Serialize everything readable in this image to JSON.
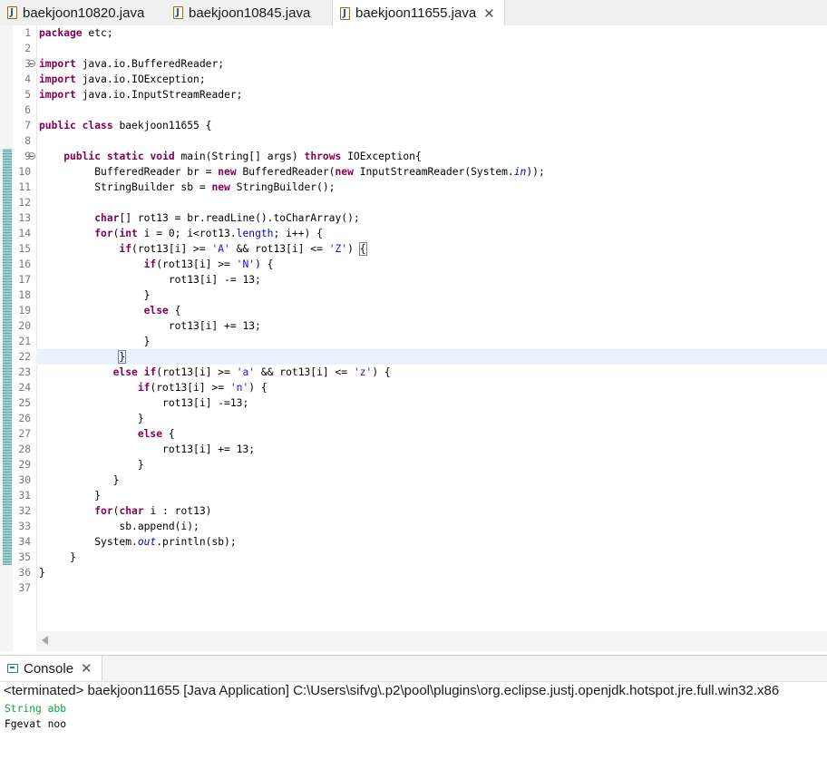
{
  "tabs": [
    {
      "label": "baekjoon10820.java",
      "active": false
    },
    {
      "label": "baekjoon10845.java",
      "active": false
    },
    {
      "label": "baekjoon11655.java",
      "active": true
    }
  ],
  "editor": {
    "current_line": 22,
    "lines": [
      {
        "n": "1",
        "html": "<span class=\"kw\">package</span> etc;"
      },
      {
        "n": "2",
        "html": ""
      },
      {
        "n": "3",
        "fold": true,
        "html": "<span class=\"kw\">import</span> java.io.BufferedReader;"
      },
      {
        "n": "4",
        "html": "<span class=\"kw\">import</span> java.io.IOException;"
      },
      {
        "n": "5",
        "html": "<span class=\"kw\">import</span> java.io.InputStreamReader;"
      },
      {
        "n": "6",
        "html": ""
      },
      {
        "n": "7",
        "html": "<span class=\"kw\">public</span> <span class=\"kw\">class</span> baekjoon11655 {"
      },
      {
        "n": "8",
        "html": ""
      },
      {
        "n": "9",
        "fold": true,
        "html": "    <span class=\"kw\">public</span> <span class=\"kw\">static</span> <span class=\"kw\">void</span> main(String[] args) <span class=\"kw\">throws</span> IOException{"
      },
      {
        "n": "10",
        "html": "         BufferedReader br = <span class=\"kw\">new</span> BufferedReader(<span class=\"kw\">new</span> InputStreamReader(System.<span class=\"fld\">in</span>));"
      },
      {
        "n": "11",
        "html": "         StringBuilder sb = <span class=\"kw\">new</span> StringBuilder();"
      },
      {
        "n": "12",
        "html": ""
      },
      {
        "n": "13",
        "html": "         <span class=\"kw\">char</span>[] rot13 = br.readLine().toCharArray();"
      },
      {
        "n": "14",
        "html": "         <span class=\"kw\">for</span>(<span class=\"kw\">int</span> i = 0; i&lt;rot13.<span class=\"fldn\">length</span>; i++) {"
      },
      {
        "n": "15",
        "html": "             <span class=\"kw\">if</span>(rot13[i] &gt;= <span class=\"str\">'A'</span> &amp;&amp; rot13[i] &lt;= <span class=\"str\">'Z'</span>) <span class=\"bracket\">{</span>"
      },
      {
        "n": "16",
        "html": "                 <span class=\"kw\">if</span>(rot13[i] &gt;= <span class=\"str\">'N'</span>) {"
      },
      {
        "n": "17",
        "html": "                     rot13[i] -= 13;"
      },
      {
        "n": "18",
        "html": "                 }"
      },
      {
        "n": "19",
        "html": "                 <span class=\"kw\">else</span> {"
      },
      {
        "n": "20",
        "html": "                     rot13[i] += 13;"
      },
      {
        "n": "21",
        "html": "                 }"
      },
      {
        "n": "22",
        "html": "             <span class=\"bracket\">}</span>"
      },
      {
        "n": "23",
        "html": "            <span class=\"kw\">else</span> <span class=\"kw\">if</span>(rot13[i] &gt;= <span class=\"str\">'a'</span> &amp;&amp; rot13[i] &lt;= <span class=\"str\">'z'</span>) {"
      },
      {
        "n": "24",
        "html": "                <span class=\"kw\">if</span>(rot13[i] &gt;= <span class=\"str\">'n'</span>) {"
      },
      {
        "n": "25",
        "html": "                    rot13[i] -=13;"
      },
      {
        "n": "26",
        "html": "                }"
      },
      {
        "n": "27",
        "html": "                <span class=\"kw\">else</span> {"
      },
      {
        "n": "28",
        "html": "                    rot13[i] += 13;"
      },
      {
        "n": "29",
        "html": "                }"
      },
      {
        "n": "30",
        "html": "            }"
      },
      {
        "n": "31",
        "html": "         }"
      },
      {
        "n": "32",
        "html": "         <span class=\"kw\">for</span>(<span class=\"kw\">char</span> i : rot13)"
      },
      {
        "n": "33",
        "html": "             sb.append(i);"
      },
      {
        "n": "34",
        "html": "         System.<span class=\"fld\">out</span>.println(sb);"
      },
      {
        "n": "35",
        "html": "     }"
      },
      {
        "n": "36",
        "html": "}"
      },
      {
        "n": "37",
        "html": ""
      }
    ]
  },
  "console": {
    "tab_label": "Console",
    "status": "<terminated> baekjoon11655 [Java Application] C:\\Users\\sifvg\\.p2\\pool\\plugins\\org.eclipse.justj.openjdk.hotspot.jre.full.win32.x86",
    "input_line": "String abb",
    "output_line": "Fgevat noo"
  },
  "colors": {
    "keyword": "#7f0055",
    "field": "#0000c0",
    "string": "#2a00ff",
    "console_input": "#0aa63a",
    "current_line_bg": "#e8f2fe",
    "change_bar": "#86c0c0"
  },
  "icons": {
    "tab_icon": "java-file-icon",
    "close_icon": "close-icon",
    "console_icon": "console-icon"
  }
}
